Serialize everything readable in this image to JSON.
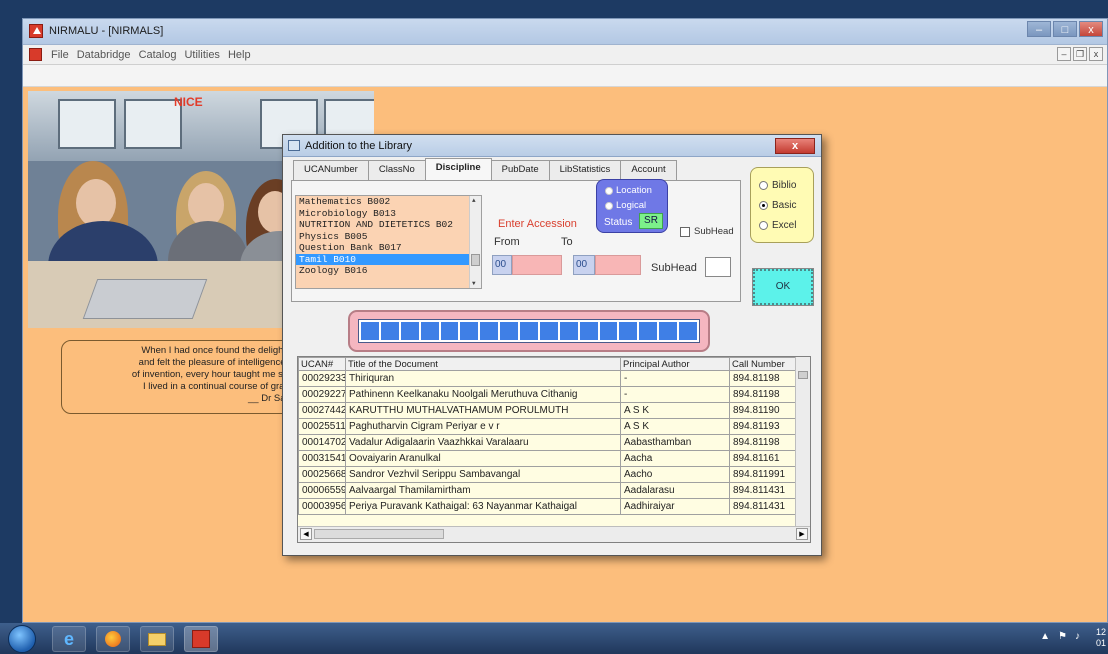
{
  "app": {
    "title": "NIRMALU - [NIRMALS]",
    "window_buttons": [
      "–",
      "□",
      "x"
    ],
    "menu": [
      "File",
      "Databridge",
      "Catalog",
      "Utilities",
      "Help"
    ],
    "mdi_buttons": [
      "–",
      "❐",
      "x"
    ]
  },
  "photo": {
    "badge": "NICE"
  },
  "quote": {
    "lines": [
      "When I had once found the delight of k",
      "and felt the pleasure of intelligence and",
      "of invention, every hour taught me somet",
      "I lived in a continual course of gratifica",
      "__ Dr Samue"
    ]
  },
  "dialog": {
    "title": "Addition to the Library",
    "close": "x",
    "tabs": [
      "UCANumber",
      "ClassNo",
      "Discipline",
      "PubDate",
      "LibStatistics",
      "Account"
    ],
    "active_tab": "Discipline",
    "subjects": [
      "Mathematics  B002",
      "Microbiology  B013",
      "NUTRITION AND DIETETICS  B02",
      "Physics  B005",
      "Question Bank  B017",
      "Tamil  B010",
      "Zoology  B016"
    ],
    "selected_subject": "Tamil  B010",
    "enter_accession": "Enter Accession",
    "from_label": "From",
    "to_label": "To",
    "from_prefix": "00",
    "to_prefix": "00",
    "status_options": [
      "Location",
      "Logical"
    ],
    "status_label": "Status",
    "status_value": "SR",
    "subhead_check": "SubHead",
    "subhead_label": "SubHead",
    "modes": [
      "Biblio",
      "Basic",
      "Excel"
    ],
    "selected_mode": "Basic",
    "ok": "OK",
    "progress": {
      "segments": 17,
      "fraction": 1.0
    },
    "grid": {
      "columns": [
        "UCAN#",
        "Title of the Document",
        "Principal Author",
        "Call Number"
      ],
      "rows": [
        [
          "00029233",
          "Thiriquran",
          "-",
          "894.81198"
        ],
        [
          "00029227",
          "Pathinenn Keelkanaku Noolgali Meruthuva Cithanig",
          "-",
          "894.81198"
        ],
        [
          "00027442",
          "KARUTTHU MUTHALVATHAMUM PORULMUTH",
          "A S K",
          "894.81190"
        ],
        [
          "00025511",
          "Paghutharvin Cigram Periyar e v r",
          "A S K",
          "894.81193"
        ],
        [
          "00014702",
          "Vadalur Adigalaarin Vaazhkkai Varalaaru",
          "Aabasthamban",
          "894.81198"
        ],
        [
          "00031541",
          "Oovaiyarin Aranulkal",
          "Aacha",
          "894.81161"
        ],
        [
          "00025668",
          "Sandror Vezhvil Serippu Sambavangal",
          "Aacho",
          "894.811991"
        ],
        [
          "00006559",
          "Aalvaargal Thamilamirtham",
          "Aadalarasu",
          "894.811431"
        ],
        [
          "00003956",
          "Periya Puravank Kathaigal: 63 Nayanmar Kathaigal",
          "Aadhiraiyar",
          "894.811431"
        ]
      ]
    }
  },
  "taskbar": {
    "icons": [
      "start-orb-icon",
      "internet-explorer-icon",
      "firefox-icon",
      "file-explorer-icon",
      "library-app-icon"
    ],
    "clock": [
      "12",
      "01"
    ]
  }
}
